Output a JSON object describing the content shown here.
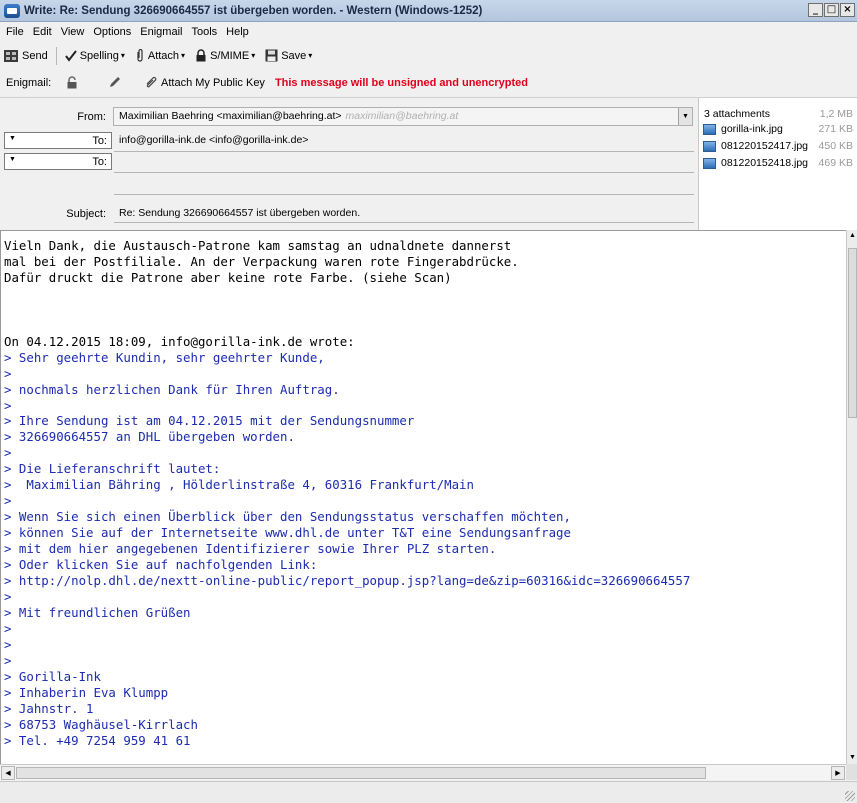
{
  "window": {
    "title": "Write: Re: Sendung 326690664557 ist übergeben worden. - Western (Windows-1252)",
    "minimize": "_",
    "maximize": "□",
    "close": "×"
  },
  "menu": [
    "File",
    "Edit",
    "View",
    "Options",
    "Enigmail",
    "Tools",
    "Help"
  ],
  "toolbar": {
    "send": "Send",
    "spelling": "Spelling",
    "attach": "Attach",
    "smime": "S/MIME",
    "save": "Save",
    "caret": "▾"
  },
  "enigmail": {
    "label": "Enigmail:",
    "attach_key": "Attach My Public Key",
    "warning": "This message will be unsigned and unencrypted"
  },
  "header": {
    "from_label": "From:",
    "from_value": "Maximilian Baehring <maximilian@baehring.at>",
    "from_ghost": "maximilian@baehring.at",
    "to_label": "To:",
    "to1_value": "info@gorilla-ink.de <info@gorilla-ink.de>",
    "to2_value": "",
    "subject_label": "Subject:",
    "subject_value": "Re: Sendung 326690664557 ist übergeben worden."
  },
  "attachments": {
    "header": "3 attachments",
    "total": "1,2 MB",
    "items": [
      {
        "name": "gorilla-ink.jpg",
        "size": "271 KB"
      },
      {
        "name": "081220152417.jpg",
        "size": "450 KB"
      },
      {
        "name": "081220152418.jpg",
        "size": "469 KB"
      }
    ]
  },
  "body": {
    "lines": [
      "Vieln Dank, die Austausch-Patrone kam samstag an udnaldnete dannerst",
      "mal bei der Postfiliale. An der Verpackung waren rote Fingerabdrücke.",
      "Dafür druckt die Patrone aber keine rote Farbe. (siehe Scan)",
      "",
      "",
      "",
      "On 04.12.2015 18:09, info@gorilla-ink.de wrote:"
    ],
    "quoted": [
      "> Sehr geehrte Kundin, sehr geehrter Kunde,",
      ">",
      "> nochmals herzlichen Dank für Ihren Auftrag.",
      ">",
      "> Ihre Sendung ist am 04.12.2015 mit der Sendungsnummer",
      "> 326690664557 an DHL übergeben worden.",
      ">",
      "> Die Lieferanschrift lautet:",
      ">  Maximilian Bähring , Hölderlinstraße 4, 60316 Frankfurt/Main",
      ">",
      "> Wenn Sie sich einen Überblick über den Sendungsstatus verschaffen möchten,",
      "> können Sie auf der Internetseite www.dhl.de unter T&T eine Sendungsanfrage",
      "> mit dem hier angegebenen Identifizierer sowie Ihrer PLZ starten.",
      "> Oder klicken Sie auf nachfolgenden Link:",
      "> http://nolp.dhl.de/nextt-online-public/report_popup.jsp?lang=de&zip=60316&idc=326690664557",
      ">",
      "> Mit freundlichen Grüßen",
      ">",
      ">",
      ">",
      "> Gorilla-Ink",
      "> Inhaberin Eva Klumpp",
      "> Jahnstr. 1",
      "> 68753 Waghäusel-Kirrlach",
      "> Tel. +49 7254 959 41 61"
    ]
  },
  "colors": {
    "quote": "#1d2bb0",
    "warning": "#e0001b",
    "titlebar": "#c8d7ea"
  }
}
